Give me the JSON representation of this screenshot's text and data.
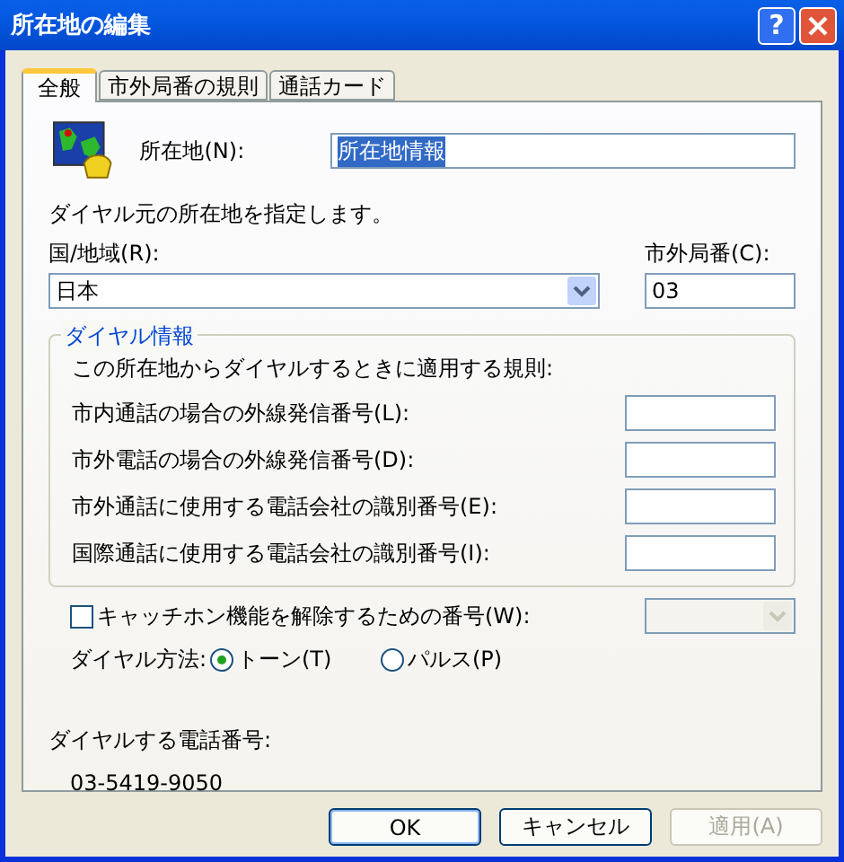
{
  "window": {
    "title": "所在地の編集",
    "help_label": "?"
  },
  "tabs": [
    {
      "label": "全般",
      "selected": true
    },
    {
      "label": "市外局番の規則",
      "selected": false
    },
    {
      "label": "通話カード",
      "selected": false
    }
  ],
  "location": {
    "label": "所在地(N):",
    "value": "所在地情報",
    "highlighted": true
  },
  "description": "ダイヤル元の所在地を指定します。",
  "country": {
    "label": "国/地域(R):",
    "value": "日本"
  },
  "area_code": {
    "label": "市外局番(C):",
    "value": "03"
  },
  "dial_info": {
    "title": "ダイヤル情報",
    "intro": "この所在地からダイヤルするときに適用する規則:",
    "fields": [
      {
        "label": "市内通話の場合の外線発信番号(L):"
      },
      {
        "label": "市外電話の場合の外線発信番号(D):"
      },
      {
        "label": "市外通話に使用する電話会社の識別番号(E):"
      },
      {
        "label": "国際通話に使用する電話会社の識別番号(I):"
      }
    ]
  },
  "call_waiting": {
    "label": "キャッチホン機能を解除するための番号(W):",
    "checked": false,
    "disabled": true
  },
  "dial_method": {
    "label": "ダイヤル方法:",
    "options": [
      {
        "label": "トーン(T)",
        "selected": true
      },
      {
        "label": "パルス(P)",
        "selected": false
      }
    ]
  },
  "number": {
    "label": "ダイヤルする電話番号:",
    "value": "03-5419-9050"
  },
  "buttons": [
    {
      "label": "OK",
      "disabled": false,
      "default": true
    },
    {
      "label": "キャンセル",
      "disabled": false,
      "default": false
    },
    {
      "label": "適用(A)",
      "disabled": true,
      "default": false
    }
  ]
}
